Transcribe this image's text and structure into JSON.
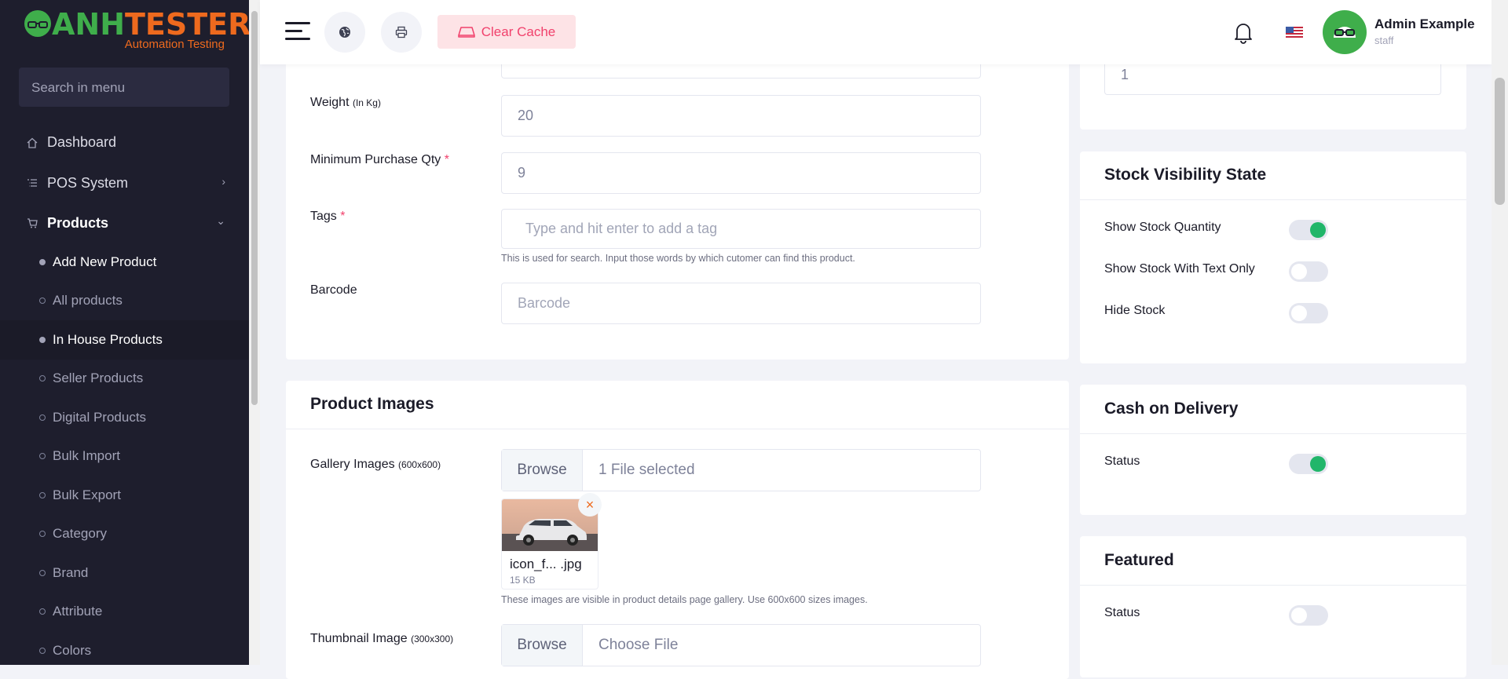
{
  "brand": {
    "logo_main": "ANHTESTER",
    "logo_sub": "Automation Testing",
    "green": "#3fae4b",
    "orange": "#ee6a1e"
  },
  "sidebar": {
    "search_placeholder": "Search in menu",
    "items": [
      {
        "label": "Dashboard",
        "icon": "home-icon"
      },
      {
        "label": "POS System",
        "icon": "list-icon"
      },
      {
        "label": "Products",
        "icon": "cart-icon"
      }
    ],
    "products_sub": [
      "Add New Product",
      "All products",
      "In House Products",
      "Seller Products",
      "Digital Products",
      "Bulk Import",
      "Bulk Export",
      "Category",
      "Brand",
      "Attribute",
      "Colors"
    ]
  },
  "header": {
    "clear_cache": "Clear Cache",
    "user_name": "Admin Example",
    "user_role": "staff"
  },
  "form": {
    "weight_label": "Weight",
    "weight_unit": "(In Kg)",
    "weight_value": "20",
    "min_qty_label": "Minimum Purchase Qty",
    "min_qty_value": "9",
    "tags_label": "Tags",
    "tags_placeholder": "Type and hit enter to add a tag",
    "tags_hint": "This is used for search. Input those words by which cutomer can find this product.",
    "barcode_label": "Barcode",
    "barcode_placeholder": "Barcode",
    "required_mark": "*"
  },
  "images": {
    "title": "Product Images",
    "gallery_label": "Gallery Images",
    "gallery_size": "(600x600)",
    "browse": "Browse",
    "gallery_status": "1 File selected",
    "thumb_name": "icon_f... .jpg",
    "thumb_size": "15 KB",
    "gallery_hint": "These images are visible in product details page gallery. Use 600x600 sizes images.",
    "thumbnail_label": "Thumbnail Image",
    "thumbnail_size": "(300x300)",
    "thumbnail_status": "Choose File"
  },
  "right": {
    "top_value": "1",
    "stock_title": "Stock Visibility State",
    "stock_options": [
      {
        "label": "Show Stock Quantity",
        "on": true
      },
      {
        "label": "Show Stock With Text Only",
        "on": false
      },
      {
        "label": "Hide Stock",
        "on": false
      }
    ],
    "cod_title": "Cash on Delivery",
    "cod_status_label": "Status",
    "cod_on": true,
    "featured_title": "Featured",
    "featured_status_label": "Status",
    "featured_on": false
  }
}
